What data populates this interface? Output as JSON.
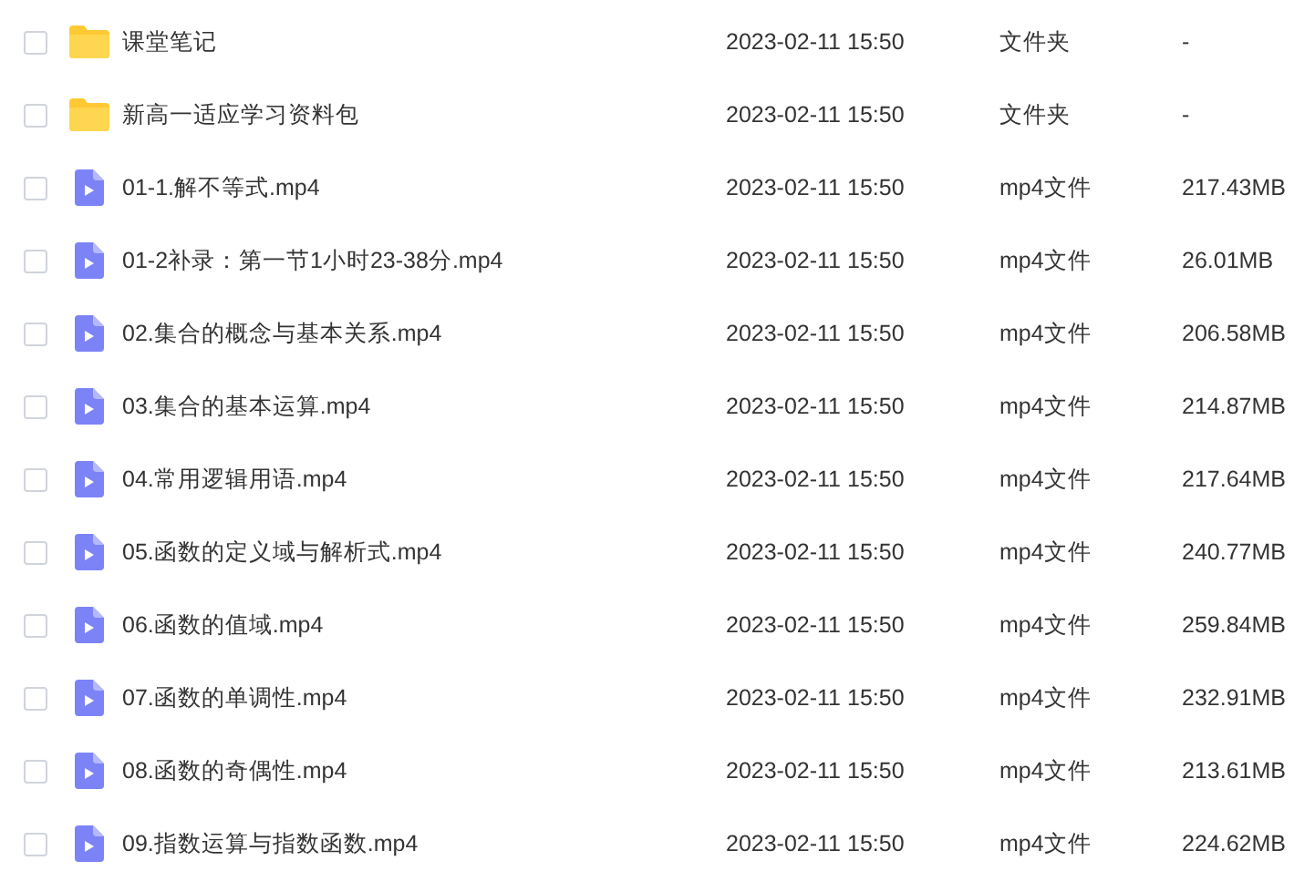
{
  "files": [
    {
      "kind": "folder",
      "name": "课堂笔记",
      "date": "2023-02-11 15:50",
      "type": "文件夹",
      "size": "-",
      "checked": false
    },
    {
      "kind": "folder",
      "name": "新高一适应学习资料包",
      "date": "2023-02-11 15:50",
      "type": "文件夹",
      "size": "-",
      "checked": false
    },
    {
      "kind": "video",
      "name": "01-1.解不等式.mp4",
      "date": "2023-02-11 15:50",
      "type": "mp4文件",
      "size": "217.43MB",
      "checked": false
    },
    {
      "kind": "video",
      "name": "01-2补录：第一节1小时23-38分.mp4",
      "date": "2023-02-11 15:50",
      "type": "mp4文件",
      "size": "26.01MB",
      "checked": false
    },
    {
      "kind": "video",
      "name": "02.集合的概念与基本关系.mp4",
      "date": "2023-02-11 15:50",
      "type": "mp4文件",
      "size": "206.58MB",
      "checked": false
    },
    {
      "kind": "video",
      "name": "03.集合的基本运算.mp4",
      "date": "2023-02-11 15:50",
      "type": "mp4文件",
      "size": "214.87MB",
      "checked": false
    },
    {
      "kind": "video",
      "name": "04.常用逻辑用语.mp4",
      "date": "2023-02-11 15:50",
      "type": "mp4文件",
      "size": "217.64MB",
      "checked": false
    },
    {
      "kind": "video",
      "name": "05.函数的定义域与解析式.mp4",
      "date": "2023-02-11 15:50",
      "type": "mp4文件",
      "size": "240.77MB",
      "checked": false
    },
    {
      "kind": "video",
      "name": "06.函数的值域.mp4",
      "date": "2023-02-11 15:50",
      "type": "mp4文件",
      "size": "259.84MB",
      "checked": false
    },
    {
      "kind": "video",
      "name": "07.函数的单调性.mp4",
      "date": "2023-02-11 15:50",
      "type": "mp4文件",
      "size": "232.91MB",
      "checked": false
    },
    {
      "kind": "video",
      "name": "08.函数的奇偶性.mp4",
      "date": "2023-02-11 15:50",
      "type": "mp4文件",
      "size": "213.61MB",
      "checked": false
    },
    {
      "kind": "video",
      "name": "09.指数运算与指数函数.mp4",
      "date": "2023-02-11 15:50",
      "type": "mp4文件",
      "size": "224.62MB",
      "checked": false
    }
  ]
}
